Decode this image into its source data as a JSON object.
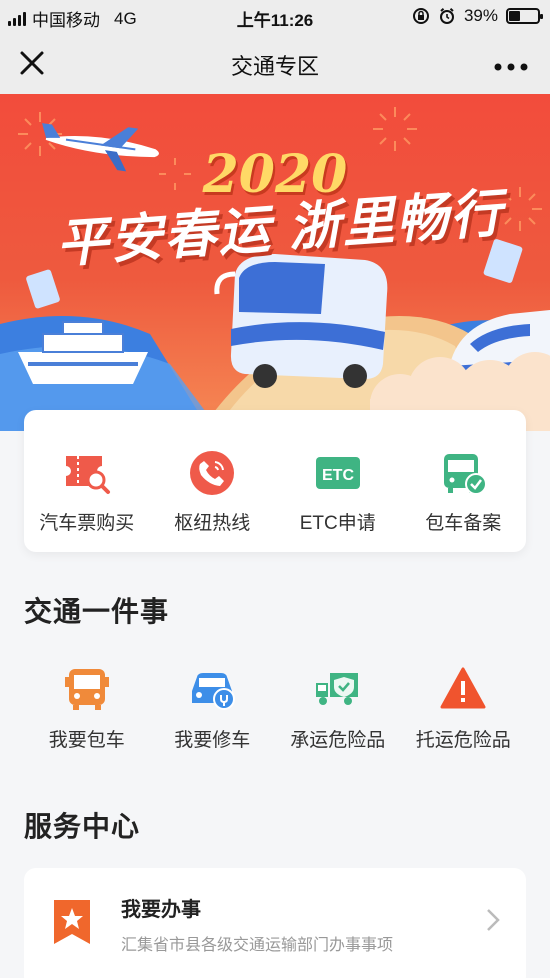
{
  "status_bar": {
    "carrier": "中国移动",
    "network": "4G",
    "time": "上午11:26",
    "battery_text": "39%",
    "battery_level": 0.39
  },
  "nav": {
    "close_icon": "close-icon",
    "title": "交通专区",
    "more_icon": "more-icon"
  },
  "banner": {
    "year": "2020",
    "slogan": "平安春运 浙里畅行"
  },
  "quick_services": [
    {
      "label": "汽车票购买",
      "icon": "bus-ticket-icon",
      "color": "#ef5a4a"
    },
    {
      "label": "枢纽热线",
      "icon": "phone-icon",
      "color": "#ef5a4a"
    },
    {
      "label": "ETC申请",
      "icon": "etc-icon",
      "color": "#3fb483"
    },
    {
      "label": "包车备案",
      "icon": "charter-bus-check-icon",
      "color": "#3fb483"
    }
  ],
  "section_matters": {
    "title": "交通一件事"
  },
  "matters": [
    {
      "label": "我要包车",
      "icon": "bus-front-icon",
      "color": "#f08a3a"
    },
    {
      "label": "我要修车",
      "icon": "car-repair-icon",
      "color": "#3d8ee8"
    },
    {
      "label": "承运危险品",
      "icon": "truck-shield-icon",
      "color": "#3fb483"
    },
    {
      "label": "托运危险品",
      "icon": "warning-icon",
      "color": "#f0542e"
    }
  ],
  "section_service": {
    "title": "服务中心"
  },
  "service_items": [
    {
      "title": "我要办事",
      "desc": "汇集省市县各级交通运输部门办事事项",
      "icon": "bookmark-star-icon",
      "color": "#f0672c"
    }
  ]
}
